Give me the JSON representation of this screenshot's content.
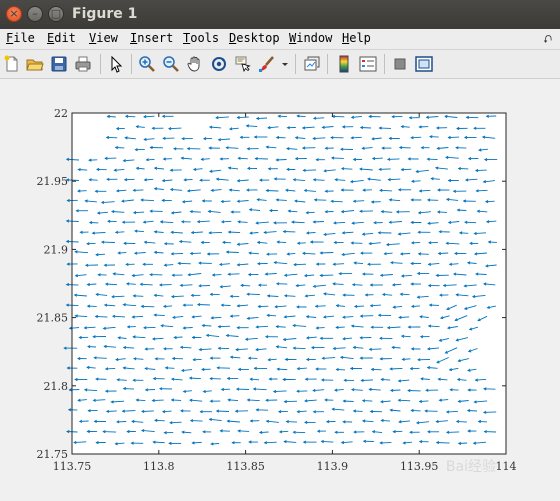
{
  "window": {
    "title": "Figure 1"
  },
  "menu": {
    "items": [
      {
        "label": "File",
        "u": "F",
        "rest": "ile"
      },
      {
        "label": "Edit",
        "u": "E",
        "rest": "dit"
      },
      {
        "label": "View",
        "u": "V",
        "rest": "iew"
      },
      {
        "label": "Insert",
        "u": "I",
        "rest": "nsert"
      },
      {
        "label": "Tools",
        "u": "T",
        "rest": "ools"
      },
      {
        "label": "Desktop",
        "u": "D",
        "rest": "esktop"
      },
      {
        "label": "Window",
        "u": "W",
        "rest": "indow"
      },
      {
        "label": "Help",
        "u": "H",
        "rest": "elp"
      }
    ],
    "overflow_arrow": "⮏"
  },
  "toolbar": {
    "buttons": [
      "new-figure-icon",
      "open-file-icon",
      "save-icon",
      "print-icon",
      "edit-plot-arrow-icon",
      "zoom-in-icon",
      "zoom-out-icon",
      "pan-hand-icon",
      "rotate-3d-icon",
      "data-cursor-icon",
      "brush-icon",
      "brush-dropdown-icon",
      "link-plot-icon",
      "colorbar-icon",
      "legend-icon",
      "hide-plot-tools-icon",
      "show-plot-tools-icon"
    ]
  },
  "chart_data": {
    "type": "quiver",
    "title": "",
    "xlabel": "",
    "ylabel": "",
    "xlim": [
      113.75,
      114
    ],
    "ylim": [
      21.75,
      22
    ],
    "xticks": [
      "113.75",
      "113.8",
      "113.85",
      "113.9",
      "113.95",
      "114"
    ],
    "yticks": [
      "21.75",
      "21.8",
      "21.85",
      "21.9",
      "21.95",
      "22"
    ],
    "vector_color": "#0072bd",
    "direction": "vectors predominantly point west (negative x)",
    "grid": false
  },
  "watermark": "Bai经验"
}
